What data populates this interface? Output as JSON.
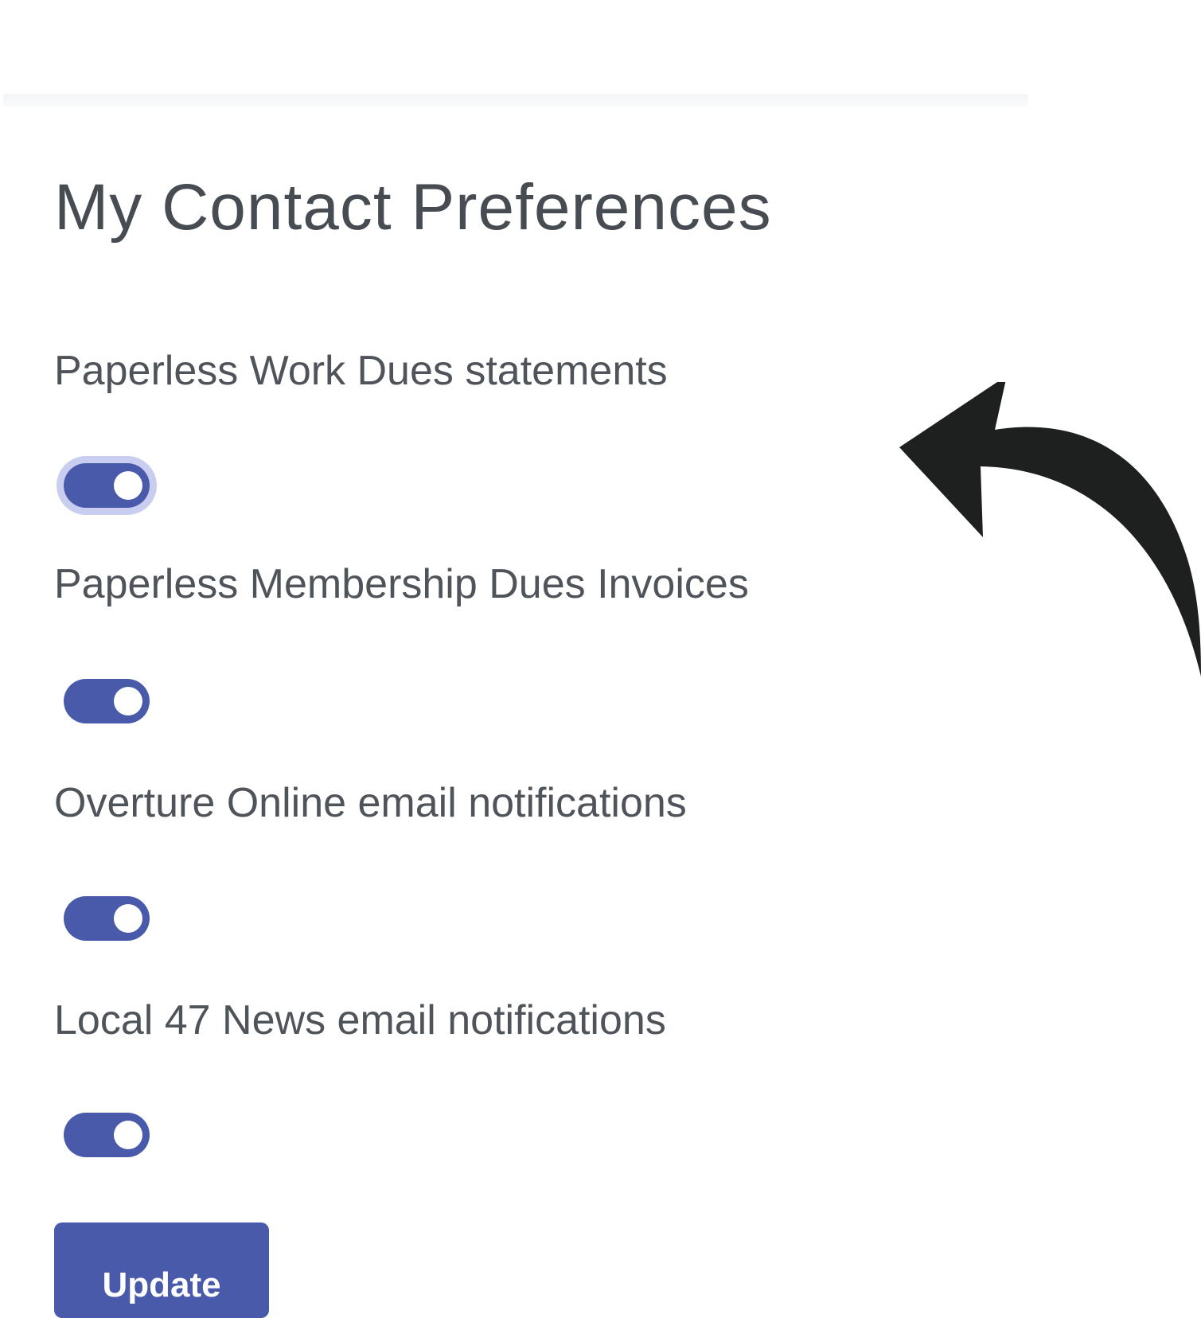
{
  "page": {
    "title": "My Contact Preferences"
  },
  "preferences": [
    {
      "label": "Paperless Work Dues statements",
      "enabled": true,
      "focused": true
    },
    {
      "label": "Paperless Membership Dues Invoices",
      "enabled": true,
      "focused": false
    },
    {
      "label": "Overture Online email notifications",
      "enabled": true,
      "focused": false
    },
    {
      "label": "Local 47 News email notifications",
      "enabled": true,
      "focused": false
    }
  ],
  "actions": {
    "update_label": "Update"
  },
  "colors": {
    "accent": "#4a5aab",
    "focus_ring": "#c9cdf0",
    "text": "#4f545a",
    "arrow": "#1e201f"
  },
  "annotation": {
    "icon": "curved-arrow-icon"
  }
}
